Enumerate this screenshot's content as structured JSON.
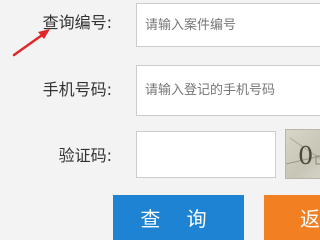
{
  "form": {
    "query_number": {
      "label": "查询编号:",
      "placeholder": "请输入案件编号"
    },
    "phone_number": {
      "label": "手机号码:",
      "placeholder": "请输入登记的手机号码"
    },
    "captcha": {
      "label": "验证码:",
      "value": "",
      "image_text": "0"
    }
  },
  "buttons": {
    "query_label": "查 询",
    "back_label": "返"
  },
  "colors": {
    "query_button": "#1e83d3",
    "back_button": "#f27f22",
    "arrow": "#e0262a"
  }
}
